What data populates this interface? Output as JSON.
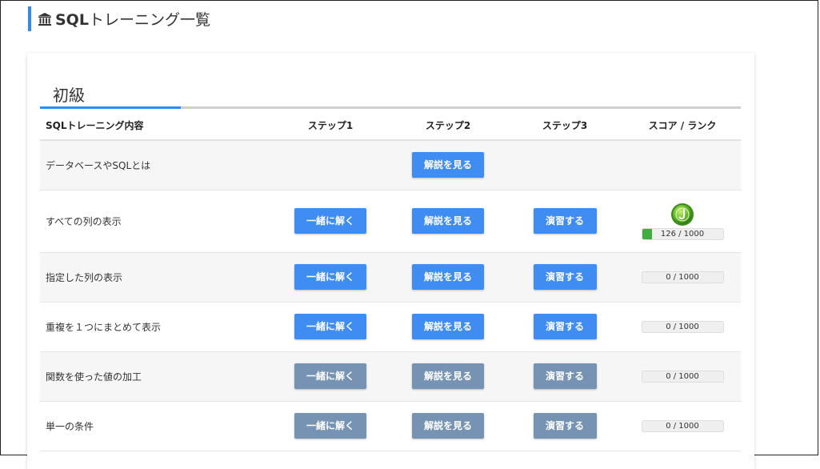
{
  "page": {
    "title_prefix": "SQL",
    "title_suffix": "トレーニング一覧"
  },
  "section": {
    "title": "初級"
  },
  "table": {
    "headers": {
      "name": "SQLトレーニング内容",
      "step1": "ステップ1",
      "step2": "ステップ2",
      "step3": "ステップ3",
      "score": "スコア / ランク"
    },
    "rows": [
      {
        "name": "データベースやSQLとは",
        "step1": "",
        "step2": "解説を見る",
        "step3": "",
        "score": "",
        "score_value": null,
        "enabled": true,
        "rank_icon": ""
      },
      {
        "name": "すべての列の表示",
        "step1": "一緒に解く",
        "step2": "解説を見る",
        "step3": "演習する",
        "score": "126 / 1000",
        "score_value": 126,
        "score_max": 1000,
        "enabled": true,
        "rank_icon": "j-rank-badge-icon"
      },
      {
        "name": "指定した列の表示",
        "step1": "一緒に解く",
        "step2": "解説を見る",
        "step3": "演習する",
        "score": "0 / 1000",
        "score_value": 0,
        "score_max": 1000,
        "enabled": true,
        "rank_icon": ""
      },
      {
        "name": "重複を１つにまとめて表示",
        "step1": "一緒に解く",
        "step2": "解説を見る",
        "step3": "演習する",
        "score": "0 / 1000",
        "score_value": 0,
        "score_max": 1000,
        "enabled": true,
        "rank_icon": ""
      },
      {
        "name": "関数を使った値の加工",
        "step1": "一緒に解く",
        "step2": "解説を見る",
        "step3": "演習する",
        "score": "0 / 1000",
        "score_value": 0,
        "score_max": 1000,
        "enabled": false,
        "rank_icon": ""
      },
      {
        "name": "単一の条件",
        "step1": "一緒に解く",
        "step2": "解説を見る",
        "step3": "演習する",
        "score": "0 / 1000",
        "score_value": 0,
        "score_max": 1000,
        "enabled": false,
        "rank_icon": ""
      }
    ]
  },
  "colors": {
    "accent": "#2d8cf0",
    "button_active": "#3f8cf2",
    "button_disabled": "#7693b4",
    "score_fill": "#3fae3f"
  }
}
